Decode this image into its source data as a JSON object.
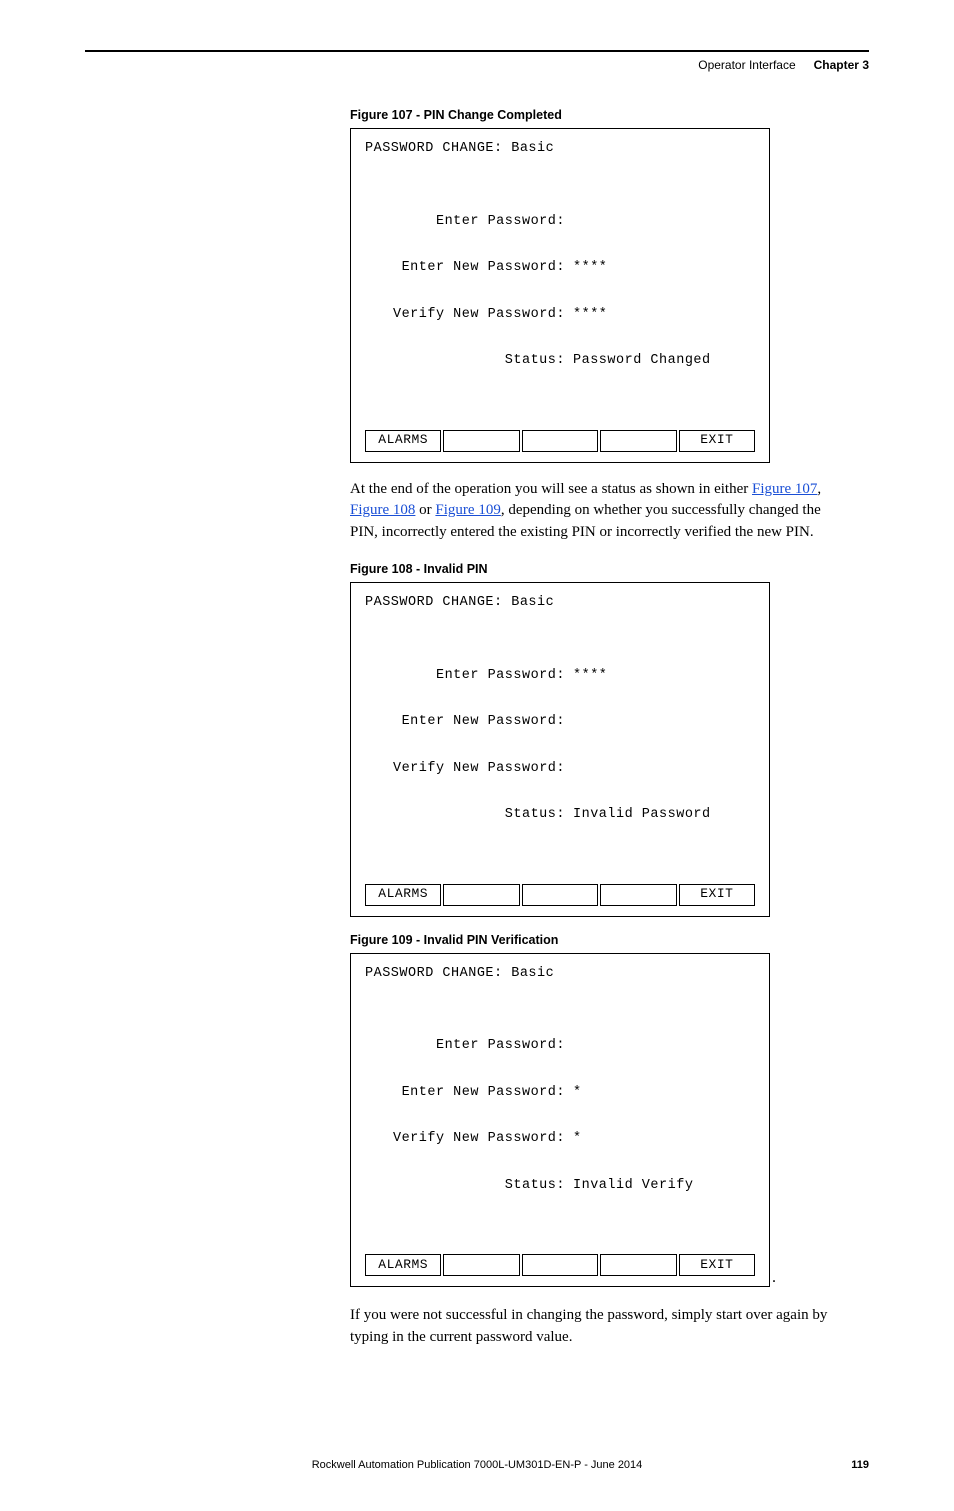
{
  "header": {
    "section": "Operator Interface",
    "chapter": "Chapter 3"
  },
  "fig107": {
    "caption": "Figure 107 - PIN Change Completed",
    "lcd": {
      "title": "PASSWORD CHANGE: Basic",
      "rows": [
        {
          "label": "Enter Password:",
          "value": ""
        },
        {
          "label": "Enter New Password:",
          "value": "****"
        },
        {
          "label": "Verify New Password:",
          "value": "****"
        },
        {
          "label": "Status:",
          "value": "Password Changed"
        }
      ],
      "buttons": [
        "ALARMS",
        "",
        "",
        "",
        "EXIT"
      ]
    }
  },
  "para1": {
    "pre": "At the end of the operation you will see a status as shown in either ",
    "link1": "Figure 107",
    "mid1": ", ",
    "link2": "Figure 108",
    "mid2": " or ",
    "link3": "Figure 109",
    "post": ", depending on whether you successfully changed the PIN, incorrectly entered the existing PIN or incorrectly verified the new PIN."
  },
  "fig108": {
    "caption": "Figure 108 - Invalid PIN",
    "lcd": {
      "title": "PASSWORD CHANGE: Basic",
      "rows": [
        {
          "label": "Enter Password:",
          "value": "****"
        },
        {
          "label": "Enter New Password:",
          "value": ""
        },
        {
          "label": "Verify New Password:",
          "value": ""
        },
        {
          "label": "Status:",
          "value": "Invalid Password"
        }
      ],
      "buttons": [
        "ALARMS",
        "",
        "",
        "",
        "EXIT"
      ]
    }
  },
  "fig109": {
    "caption": "Figure 109 - Invalid PIN Verification",
    "lcd": {
      "title": "PASSWORD CHANGE: Basic",
      "rows": [
        {
          "label": "Enter Password:",
          "value": ""
        },
        {
          "label": "Enter New Password:",
          "value": "*"
        },
        {
          "label": "Verify New Password:",
          "value": "*"
        },
        {
          "label": "Status:",
          "value": "Invalid Verify"
        }
      ],
      "buttons": [
        "ALARMS",
        "",
        "",
        "",
        "EXIT"
      ]
    },
    "trailing_period": "."
  },
  "para2": "If you were not successful in changing the password, simply start over again by typing in the current password value.",
  "footer": {
    "publication": "Rockwell Automation Publication 7000L-UM301D-EN-P - June 2014",
    "page": "119"
  }
}
